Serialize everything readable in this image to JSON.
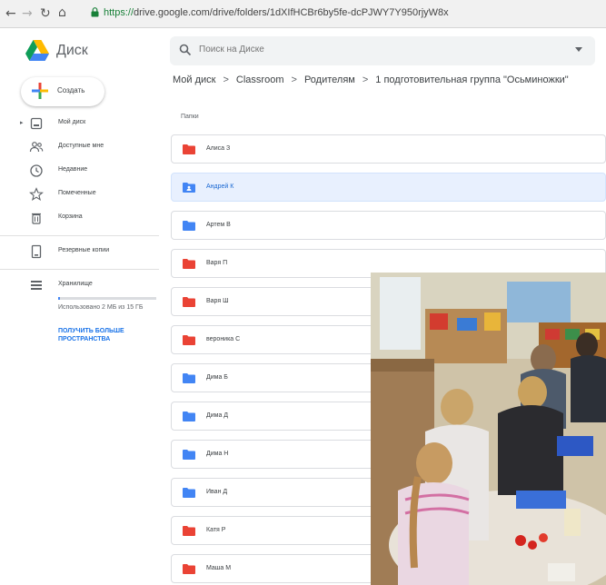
{
  "browser": {
    "url_scheme": "https://",
    "url_rest": "drive.google.com/drive/folders/1dXIfHCBr6by5fe-dcPJWY7Y950rjyW8x"
  },
  "header": {
    "app_name": "Диск",
    "search_placeholder": "Поиск на Диске"
  },
  "sidebar": {
    "create_label": "Создать",
    "items": [
      {
        "label": "Мой диск",
        "icon": "my-drive-icon"
      },
      {
        "label": "Доступные мне",
        "icon": "shared-with-me-icon"
      },
      {
        "label": "Недавние",
        "icon": "recent-clock-icon"
      },
      {
        "label": "Помеченные",
        "icon": "star-icon"
      },
      {
        "label": "Корзина",
        "icon": "trash-icon"
      },
      {
        "label": "Резервные копии",
        "icon": "backup-icon"
      },
      {
        "label": "Хранилище",
        "icon": "storage-icon"
      }
    ],
    "storage_used": "Использовано 2 МБ из 15 ГБ",
    "storage_fraction": 0.02,
    "upgrade_label": "Получить больше пространства"
  },
  "breadcrumb": [
    "Мой диск",
    "Classroom",
    "Родителям",
    "1 подготовительная группа \"Осьминожки\""
  ],
  "section_label": "Папки",
  "folders": [
    {
      "name": "Алиса З",
      "color": "#ea4335",
      "selected": false
    },
    {
      "name": "Андрей К",
      "color": "#4285f4",
      "selected": true
    },
    {
      "name": "Артем В",
      "color": "#4285f4",
      "selected": false
    },
    {
      "name": "Варя П",
      "color": "#ea4335",
      "selected": false
    },
    {
      "name": "Варя Ш",
      "color": "#ea4335",
      "selected": false
    },
    {
      "name": "вероника С",
      "color": "#ea4335",
      "selected": false
    },
    {
      "name": "Дима Б",
      "color": "#4285f4",
      "selected": false
    },
    {
      "name": "Дима Д",
      "color": "#4285f4",
      "selected": false
    },
    {
      "name": "Дима Н",
      "color": "#4285f4",
      "selected": false
    },
    {
      "name": "Иван Д",
      "color": "#4285f4",
      "selected": false
    },
    {
      "name": "Катя Р",
      "color": "#ea4335",
      "selected": false
    },
    {
      "name": "Маша М",
      "color": "#ea4335",
      "selected": false
    }
  ],
  "colors": {
    "accent": "#1a73e8",
    "selected_bg": "#e8f0fe",
    "folder_red": "#ea4335",
    "folder_blue": "#4285f4"
  }
}
